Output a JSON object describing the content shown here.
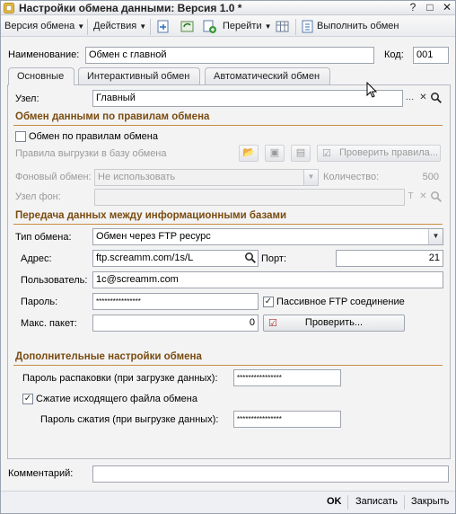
{
  "window": {
    "title": "Настройки обмена данными: Версия 1.0 *",
    "controls": [
      "?",
      "□",
      "✕"
    ]
  },
  "toolbar": {
    "version_menu": "Версия обмена",
    "actions_menu": "Действия",
    "goto_menu": "Перейти",
    "run_exchange": "Выполнить обмен"
  },
  "header": {
    "name_label": "Наименование:",
    "name_value": "Обмен с главной",
    "code_label": "Код:",
    "code_value": "001"
  },
  "tabs": [
    {
      "label": "Основные"
    },
    {
      "label": "Интерактивный обмен"
    },
    {
      "label": "Автоматический обмен"
    }
  ],
  "main": {
    "node_label": "Узел:",
    "node_value": "Главный",
    "rules_section": "Обмен данными по правилам обмена",
    "rules_checkbox": "Обмен по правилам обмена",
    "upload_rules_label": "Правила выгрузки в базу обмена",
    "check_rules_button": "Проверить правила...",
    "background_label": "Фоновый обмен:",
    "background_value": "Не использовать",
    "count_label": "Количество:",
    "count_value": "500",
    "bg_node_label": "Узел фон:",
    "transfer_section": "Передача данных между информационными базами",
    "exchange_type_label": "Тип обмена:",
    "exchange_type_value": "Обмен через FTP ресурс",
    "address_label": "Адрес:",
    "address_value": "ftp.screamm.com/1s/L",
    "port_label": "Порт:",
    "port_value": "21",
    "user_label": "Пользователь:",
    "user_value": "1c@screamm.com",
    "password_label": "Пароль:",
    "password_value": "****************",
    "passive_ftp": "Пассивное FTP соединение",
    "max_packet_label": "Макс. пакет:",
    "max_packet_value": "0",
    "check_button": "Проверить...",
    "extra_section": "Дополнительные настройки обмена",
    "unpack_password_label": "Пароль распаковки (при загрузке данных):",
    "unpack_password_value": "****************",
    "compress_checkbox": "Сжатие исходящего файла обмена",
    "compress_password_label": "Пароль сжатия (при выгрузке данных):",
    "compress_password_value": "****************"
  },
  "comment": {
    "label": "Комментарий:",
    "value": ""
  },
  "footer": {
    "ok": "OK",
    "save": "Записать",
    "close": "Закрыть"
  }
}
